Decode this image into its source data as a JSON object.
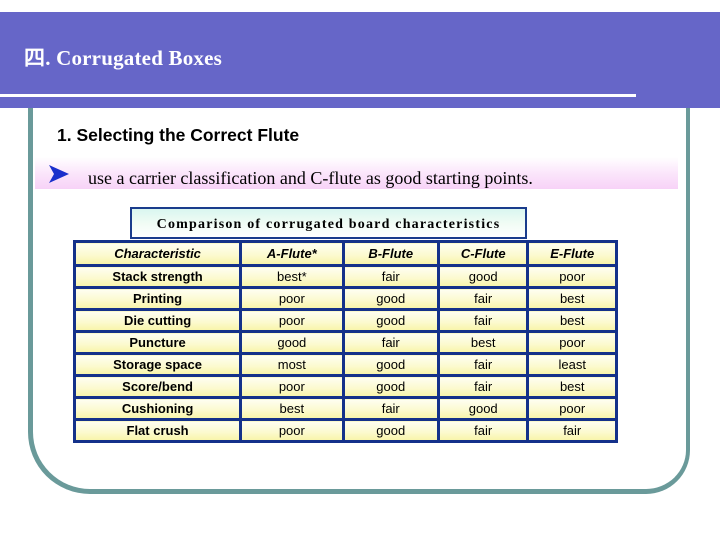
{
  "header": {
    "title": "四. Corrugated Boxes",
    "banner_color": "#6666c8"
  },
  "section": {
    "heading": "1. Selecting the Correct Flute",
    "bullet_icon": "arrow-right-icon",
    "bullet_text": "use a carrier classification and C-flute as good starting points."
  },
  "table": {
    "caption": "Comparison of corrugated board characteristics",
    "columns": [
      "Characteristic",
      "A-Flute*",
      "B-Flute",
      "C-Flute",
      "E-Flute"
    ],
    "rows": [
      [
        "Stack strength",
        "best*",
        "fair",
        "good",
        "poor"
      ],
      [
        "Printing",
        "poor",
        "good",
        "fair",
        "best"
      ],
      [
        "Die cutting",
        "poor",
        "good",
        "fair",
        "best"
      ],
      [
        "Puncture",
        "good",
        "fair",
        "best",
        "poor"
      ],
      [
        "Storage space",
        "most",
        "good",
        "fair",
        "least"
      ],
      [
        "Score/bend",
        "poor",
        "good",
        "fair",
        "best"
      ],
      [
        "Cushioning",
        "best",
        "fair",
        "good",
        "poor"
      ],
      [
        "Flat crush",
        "poor",
        "good",
        "fair",
        "fair"
      ]
    ]
  },
  "colors": {
    "frame": "#6a9a9a",
    "table_border": "#14318a",
    "bullet_arrow": "#1a2fcc"
  }
}
